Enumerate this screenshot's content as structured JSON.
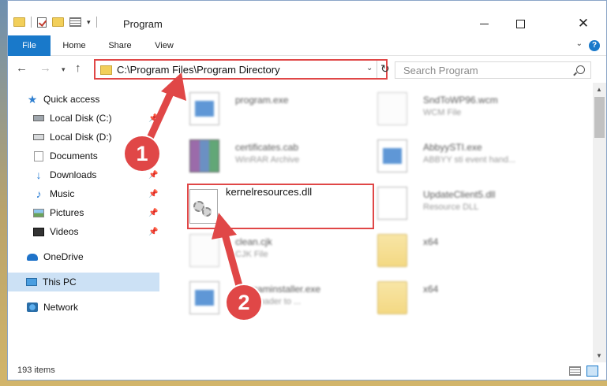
{
  "window": {
    "title": "Program"
  },
  "ribbon": {
    "tabs": [
      "File",
      "Home",
      "Share",
      "View"
    ]
  },
  "address": {
    "path": "C:\\Program Files\\Program Directory"
  },
  "search": {
    "placeholder": "Search Program"
  },
  "sidebar": {
    "items": [
      {
        "label": "Quick access",
        "icon": "star-icon",
        "pinned": false
      },
      {
        "label": "Local Disk (C:)",
        "icon": "disk-icon",
        "pinned": true
      },
      {
        "label": "Local Disk (D:)",
        "icon": "disk-icon",
        "pinned": false
      },
      {
        "label": "Documents",
        "icon": "documents-icon",
        "pinned": true
      },
      {
        "label": "Downloads",
        "icon": "download-icon",
        "pinned": true
      },
      {
        "label": "Music",
        "icon": "music-icon",
        "pinned": true
      },
      {
        "label": "Pictures",
        "icon": "pictures-icon",
        "pinned": true
      },
      {
        "label": "Videos",
        "icon": "video-icon",
        "pinned": true
      },
      {
        "label": "OneDrive",
        "icon": "cloud-icon",
        "pinned": false
      },
      {
        "label": "This PC",
        "icon": "computer-icon",
        "pinned": false,
        "selected": true
      },
      {
        "label": "Network",
        "icon": "network-icon",
        "pinned": false
      }
    ]
  },
  "files": {
    "left": [
      {
        "name": "program.exe",
        "sub": ""
      },
      {
        "name": "certificates.cab",
        "sub": "WinRAR Archive"
      },
      {
        "name": "kernelresources.dll",
        "sub": ""
      },
      {
        "name": "clean.cjk",
        "sub": "CJK File"
      },
      {
        "name": "programinstaller.exe",
        "sub": "Downloader to ..."
      }
    ],
    "right": [
      {
        "name": "SndToWP96.wcm",
        "sub": "WCM File"
      },
      {
        "name": "AbbyySTI.exe",
        "sub": "ABBYY sti event hand..."
      },
      {
        "name": "UpdateClient5.dll",
        "sub": "Resource DLL"
      },
      {
        "name": "x64",
        "sub": ""
      },
      {
        "name": "x64",
        "sub": ""
      }
    ]
  },
  "status": {
    "count": "193 items"
  },
  "callouts": [
    "1",
    "2"
  ],
  "colors": {
    "accent": "#1979ca",
    "highlight": "#e04747",
    "selection": "#cce1f5"
  }
}
